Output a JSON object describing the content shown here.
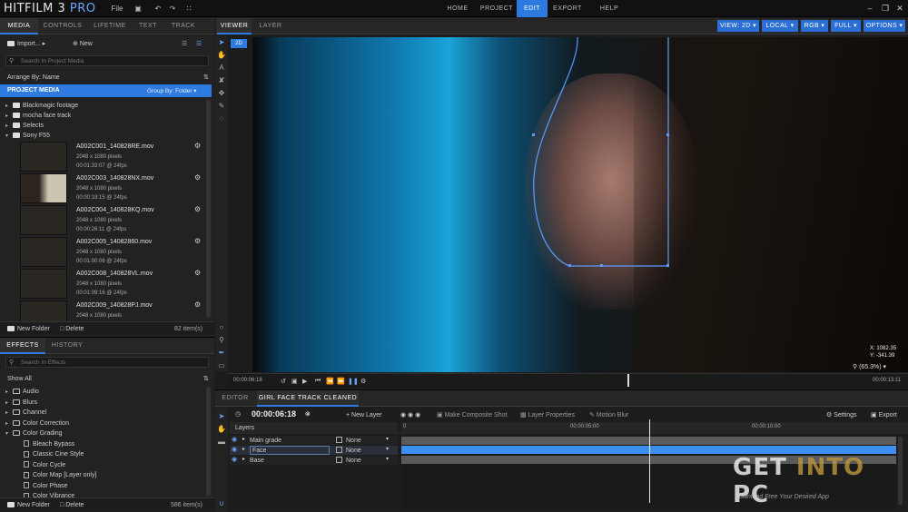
{
  "app": {
    "name": "HITFILM 3",
    "edition": "PRO"
  },
  "menu": {
    "file": "File"
  },
  "topnav": [
    "HOME",
    "PROJECT",
    "EDIT",
    "EXPORT",
    "HELP"
  ],
  "leftTabs": [
    "MEDIA",
    "CONTROLS",
    "LIFETIME",
    "TEXT",
    "TRACK"
  ],
  "media": {
    "import": "Import...",
    "new": "New",
    "search_placeholder": "Search In Project Media",
    "arrange": "Arrange By: Name",
    "project_media": "PROJECT MEDIA",
    "group_by": "Group By: Folder",
    "folders": [
      "Blackmagic footage",
      "mocha face track",
      "Selects",
      "Sony F55"
    ],
    "files": [
      {
        "name": "A002C001_140828RE.mov",
        "res": "2048 x 1080 pixels",
        "dur": "00:01:33:07 @ 24fps"
      },
      {
        "name": "A002C003_140828NX.mov",
        "res": "2048 x 1080 pixels",
        "dur": "00:00:19:15 @ 24fps"
      },
      {
        "name": "A002C004_140828KQ.mov",
        "res": "2048 x 1080 pixels",
        "dur": "00:00:26:11 @ 24fps"
      },
      {
        "name": "A002C005_14082860.mov",
        "res": "2048 x 1080 pixels",
        "dur": "00:01:00:06 @ 24fps"
      },
      {
        "name": "A002C008_140828VL.mov",
        "res": "2048 x 1080 pixels",
        "dur": "00:01:09:16 @ 24fps"
      },
      {
        "name": "A002C009_140828PJ.mov",
        "res": "2048 x 1080 pixels",
        "dur": "00:01:00:11 @ 24fps"
      }
    ],
    "new_folder": "New Folder",
    "delete": "Delete",
    "count": "82 item(s)"
  },
  "effects": {
    "tabs": [
      "EFFECTS",
      "HISTORY"
    ],
    "search_placeholder": "Search In Effects",
    "show": "Show All",
    "categories": [
      "Audio",
      "Blurs",
      "Channel",
      "Color Correction",
      "Color Grading"
    ],
    "items": [
      "Bleach Bypass",
      "Classic Cine Style",
      "Color Cycle",
      "Color Map [Layer only]",
      "Color Phase",
      "Color Vibrance"
    ],
    "new_folder": "New Folder",
    "delete": "Delete",
    "count": "586 item(s)"
  },
  "viewer": {
    "tabs": [
      "VIEWER",
      "LAYER"
    ],
    "badge": "2D",
    "dropdowns": [
      "VIEW: 2D",
      "LOCAL",
      "RGB",
      "FULL",
      "OPTIONS"
    ],
    "coord_x": "X: 1082.35",
    "coord_y": "Y: -341.39",
    "zoom": "(65.3%)",
    "time_start": "00:00:06:18",
    "time_end": "00:00:13:11",
    "playhead": 0.63
  },
  "editor": {
    "tabs": [
      "EDITOR",
      "GIRL FACE TRACK CLEANED"
    ],
    "timecode": "00:00:06:18",
    "new_layer": "New Layer",
    "make_composite": "Make Composite Shot",
    "layer_props": "Layer Properties",
    "motion_blur": "Motion Blur",
    "settings": "Settings",
    "export": "Export",
    "layers_label": "Layers",
    "ruler": [
      "0",
      "00:00:05:00",
      "00:00:10:00"
    ],
    "layers": [
      {
        "name": "Main grade",
        "blend": "None"
      },
      {
        "name": "Face",
        "blend": "None"
      },
      {
        "name": "Base",
        "blend": "None"
      }
    ],
    "playhead": 0.5
  },
  "watermark": {
    "title_a": "GET ",
    "title_b": "INTO",
    "title_c": " PC",
    "sub": "Download Free Your Desired App"
  },
  "colors": {
    "accent": "#2d7ae0",
    "track": "#3d8ff0",
    "bg": "#1e1e1e"
  }
}
